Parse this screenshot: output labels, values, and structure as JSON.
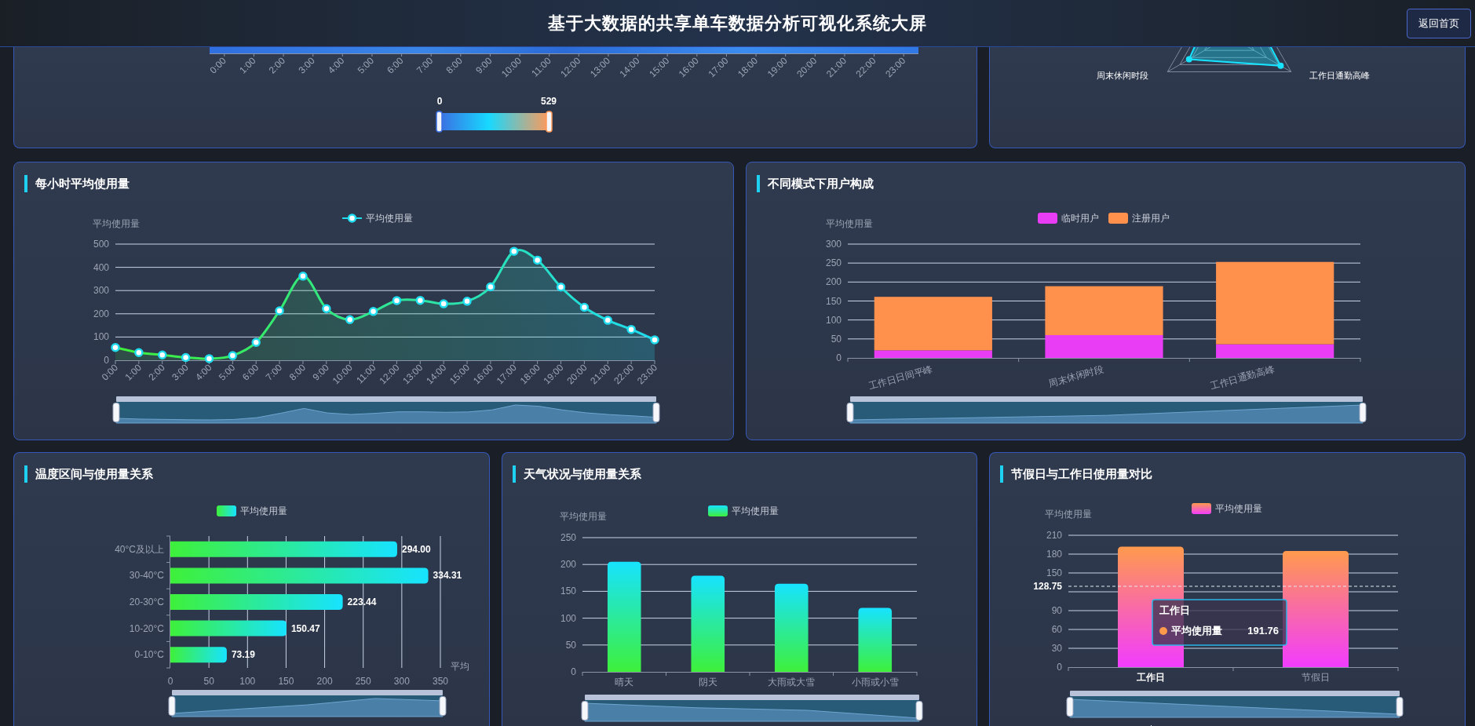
{
  "header": {
    "title": "基于大数据的共享单车数据分析可视化系统大屏",
    "back_button": "返回首页"
  },
  "heatmap_panel": {
    "hours": [
      "0:00",
      "1:00",
      "2:00",
      "3:00",
      "4:00",
      "5:00",
      "6:00",
      "7:00",
      "8:00",
      "9:00",
      "10:00",
      "11:00",
      "12:00",
      "13:00",
      "14:00",
      "15:00",
      "16:00",
      "17:00",
      "18:00",
      "19:00",
      "20:00",
      "21:00",
      "22:00",
      "23:00"
    ],
    "visual_map": {
      "min": "0",
      "max": "529"
    }
  },
  "radar_panel": {
    "indicators": [
      "周末休闲时段",
      "工作日通勤高峰"
    ]
  },
  "panels": [
    {
      "title": "每小时平均使用量",
      "chart_data": {
        "type": "area",
        "legend": "top",
        "grid": true,
        "ylabel": "平均使用量",
        "categories": [
          "0:00",
          "1:00",
          "2:00",
          "3:00",
          "4:00",
          "5:00",
          "6:00",
          "7:00",
          "8:00",
          "9:00",
          "10:00",
          "11:00",
          "12:00",
          "13:00",
          "14:00",
          "15:00",
          "16:00",
          "17:00",
          "18:00",
          "19:00",
          "20:00",
          "21:00",
          "22:00",
          "23:00"
        ],
        "ylim": [
          0,
          500
        ],
        "yticks": [
          0,
          100,
          200,
          300,
          400,
          500
        ],
        "series": [
          {
            "name": "平均使用量",
            "color": "#1fdcef",
            "marker": "circle",
            "values": [
              55,
              33,
              23,
              12,
              7,
              20,
              77,
              213,
              362,
              222,
              175,
              210,
              257,
              258,
              243,
              254,
              316,
              469,
              431,
              315,
              228,
              172,
              133,
              88
            ]
          }
        ]
      }
    },
    {
      "title": "不同模式下用户构成",
      "chart_data": {
        "type": "bar",
        "stacked": true,
        "legend": "top",
        "grid": true,
        "ylabel": "平均使用量",
        "categories": [
          "工作日日间平峰",
          "周末休闲时段",
          "工作日通勤高峰"
        ],
        "ylim": [
          0,
          300
        ],
        "yticks": [
          0,
          50,
          100,
          150,
          200,
          250,
          300
        ],
        "series": [
          {
            "name": "临时用户",
            "color": "#e93cf5",
            "values": [
              20,
              60,
              36
            ]
          },
          {
            "name": "注册用户",
            "color": "#ff914d",
            "values": [
              141,
              129,
              217
            ]
          }
        ]
      }
    },
    {
      "title": "温度区间与使用量关系",
      "chart_data": {
        "type": "bar",
        "orientation": "horizontal",
        "legend": "top",
        "grid": true,
        "xlabel": "平均",
        "categories": [
          "40°C及以上",
          "30-40°C",
          "20-30°C",
          "10-20°C",
          "0-10°C"
        ],
        "xlim": [
          0,
          350
        ],
        "xticks": [
          0,
          50,
          100,
          150,
          200,
          250,
          300,
          350
        ],
        "value_labels": [
          "294.00",
          "334.31",
          "223.44",
          "150.47",
          "73.19"
        ],
        "series": [
          {
            "name": "平均使用量",
            "color": "#17e3ff",
            "values": [
              294.0,
              334.31,
              223.44,
              150.47,
              73.19
            ]
          }
        ]
      }
    },
    {
      "title": "天气状况与使用量关系",
      "chart_data": {
        "type": "bar",
        "legend": "top",
        "grid": true,
        "ylabel": "平均使用量",
        "categories": [
          "晴天",
          "阴天",
          "大雨或大雪",
          "小雨或小雪"
        ],
        "ylim": [
          0,
          250
        ],
        "yticks": [
          0,
          50,
          100,
          150,
          200,
          250
        ],
        "series": [
          {
            "name": "平均使用量",
            "color": "#17e3ff",
            "values": [
              205,
              179,
              164,
              119
            ]
          }
        ]
      }
    },
    {
      "title": "节假日与工作日使用量对比",
      "tooltip": {
        "title": "工作日",
        "series": "平均使用量",
        "value": "191.76"
      },
      "chart_data": {
        "type": "bar",
        "legend": "top",
        "grid": true,
        "ylabel": "平均使用量",
        "categories": [
          "工作日",
          "节假日"
        ],
        "ylim": [
          0,
          210
        ],
        "yticks": [
          0,
          30,
          60,
          90,
          150,
          180,
          210
        ],
        "series": [
          {
            "name": "平均使用量",
            "color": "#ff9a4d",
            "values": [
              191.76,
              185
            ]
          }
        ],
        "ref_lines": [
          {
            "axis": "y",
            "value": 128.75,
            "label": "128.75"
          }
        ]
      }
    }
  ]
}
